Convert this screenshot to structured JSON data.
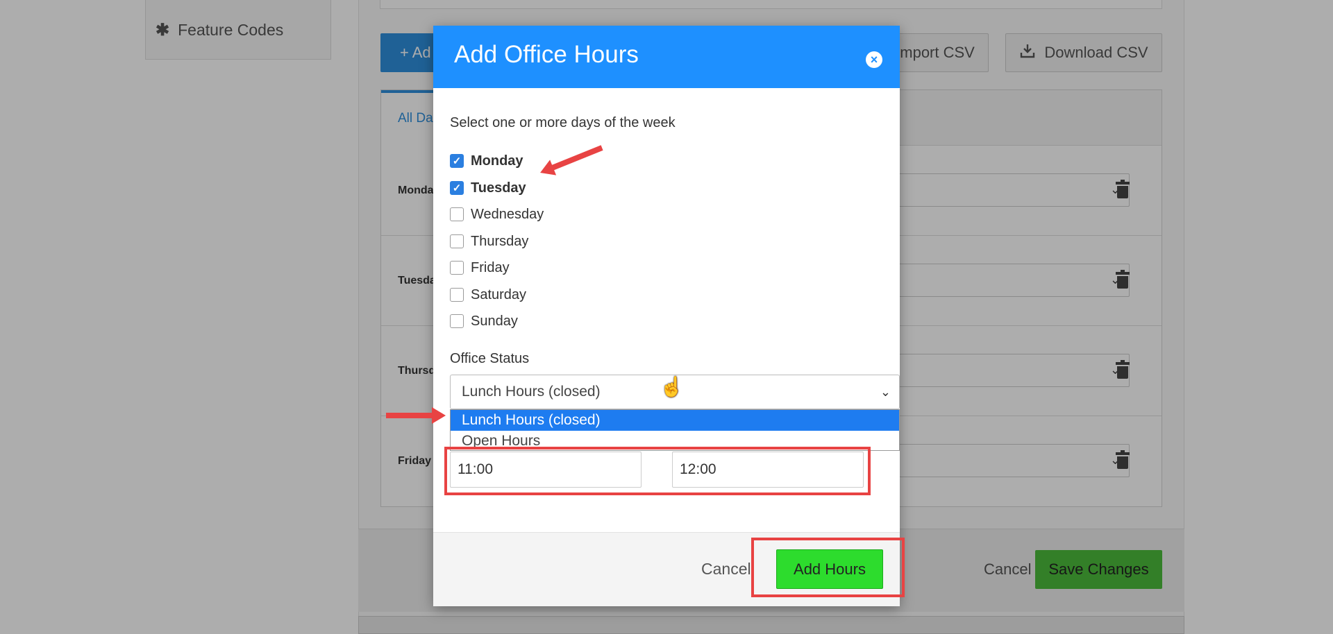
{
  "sidebar": {
    "feature_codes_label": "Feature Codes",
    "feature_codes_icon": "asterisk-icon"
  },
  "toolbar": {
    "add_label": "+ Ad",
    "import_label": "Import CSV",
    "download_label": "Download CSV"
  },
  "table": {
    "tab_all": "All Da",
    "rows": [
      {
        "label": "Monda"
      },
      {
        "label": "Tuesda"
      },
      {
        "label": "Thursd"
      },
      {
        "label": "Friday"
      }
    ]
  },
  "page_footer": {
    "cancel_label": "Cancel",
    "save_label": "Save Changes"
  },
  "modal": {
    "title": "Add Office Hours",
    "instruction": "Select one or more days of the week",
    "days": [
      {
        "label": "Monday",
        "checked": true
      },
      {
        "label": "Tuesday",
        "checked": true
      },
      {
        "label": "Wednesday",
        "checked": false
      },
      {
        "label": "Thursday",
        "checked": false
      },
      {
        "label": "Friday",
        "checked": false
      },
      {
        "label": "Saturday",
        "checked": false
      },
      {
        "label": "Sunday",
        "checked": false
      }
    ],
    "status_label": "Office Status",
    "status_value": "Lunch Hours (closed)",
    "status_options": [
      "Lunch Hours (closed)",
      "Open Hours"
    ],
    "start_time": "11:00",
    "end_time": "12:00",
    "cancel_label": "Cancel",
    "add_label": "Add Hours"
  },
  "colors": {
    "header_blue": "#1e90ff",
    "highlight_red": "#e84343",
    "add_green": "#2ddc2d"
  }
}
